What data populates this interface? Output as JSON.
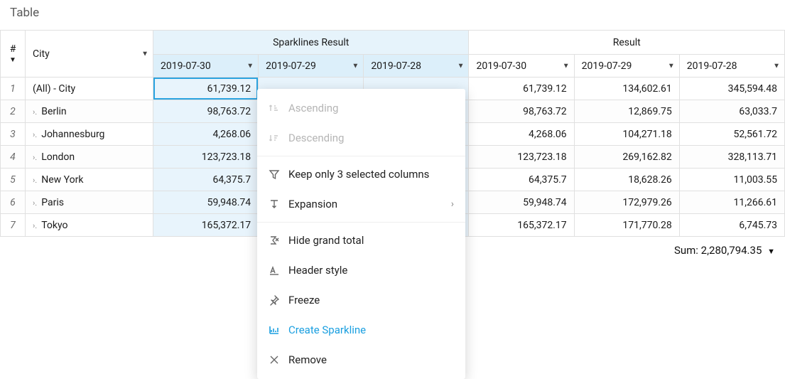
{
  "title": "Table",
  "headers": {
    "index": "#",
    "city": "City",
    "group_sparklines": "Sparklines Result",
    "group_result": "Result",
    "dates": [
      "2019-07-30",
      "2019-07-29",
      "2019-07-28"
    ]
  },
  "rows": [
    {
      "idx": "1",
      "city": "(All) - City",
      "drill": false,
      "spark": [
        "61,739.12",
        "",
        ""
      ],
      "result": [
        "61,739.12",
        "134,602.61",
        "345,594.48"
      ]
    },
    {
      "idx": "2",
      "city": "Berlin",
      "drill": true,
      "spark": [
        "98,763.72",
        "",
        ""
      ],
      "result": [
        "98,763.72",
        "12,869.75",
        "63,033.7"
      ]
    },
    {
      "idx": "3",
      "city": "Johannesburg",
      "drill": true,
      "spark": [
        "4,268.06",
        "",
        ""
      ],
      "result": [
        "4,268.06",
        "104,271.18",
        "52,561.72"
      ]
    },
    {
      "idx": "4",
      "city": "London",
      "drill": true,
      "spark": [
        "123,723.18",
        "",
        ""
      ],
      "result": [
        "123,723.18",
        "269,162.82",
        "328,113.71"
      ]
    },
    {
      "idx": "5",
      "city": "New York",
      "drill": true,
      "spark": [
        "64,375.7",
        "",
        ""
      ],
      "result": [
        "64,375.7",
        "18,628.26",
        "11,003.55"
      ]
    },
    {
      "idx": "6",
      "city": "Paris",
      "drill": true,
      "spark": [
        "59,948.74",
        "",
        ""
      ],
      "result": [
        "59,948.74",
        "172,979.26",
        "11,266.61"
      ]
    },
    {
      "idx": "7",
      "city": "Tokyo",
      "drill": true,
      "spark": [
        "165,372.17",
        "",
        ""
      ],
      "result": [
        "165,372.17",
        "171,770.28",
        "6,745.73"
      ]
    }
  ],
  "summary": {
    "label": "Sum:",
    "value": "2,280,794.35"
  },
  "menu": {
    "ascending": "Ascending",
    "descending": "Descending",
    "keep_only": "Keep only 3 selected columns",
    "expansion": "Expansion",
    "hide_grand_total": "Hide grand total",
    "header_style": "Header style",
    "freeze": "Freeze",
    "create_sparkline": "Create Sparkline",
    "remove": "Remove"
  }
}
